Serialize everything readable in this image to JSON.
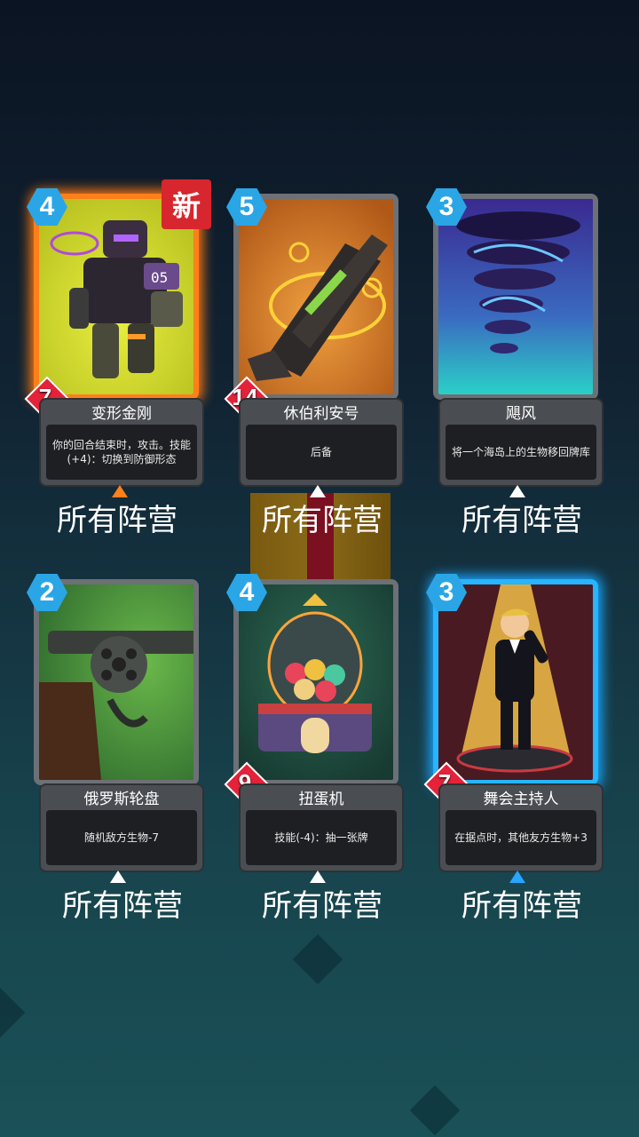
{
  "cards": [
    {
      "cost": "4",
      "attack": "7",
      "name": "变形金刚",
      "desc": "你的回合结束时，攻击。技能(+4)：切换到防御形态",
      "faction": "所有阵营",
      "badge": "新",
      "glow": "orange",
      "art": "transformer-robot-art"
    },
    {
      "cost": "5",
      "attack": "14",
      "name": "休伯利安号",
      "desc": "后备",
      "faction": "所有阵营",
      "glow": "none",
      "art": "spaceship-art"
    },
    {
      "cost": "3",
      "name": "飓风",
      "desc": "将一个海岛上的生物移回牌库",
      "faction": "所有阵营",
      "glow": "none",
      "art": "tornado-art"
    },
    {
      "cost": "2",
      "name": "俄罗斯轮盘",
      "desc": "随机敌方生物-7",
      "faction": "所有阵营",
      "glow": "none",
      "art": "revolver-art"
    },
    {
      "cost": "4",
      "attack": "9",
      "name": "扭蛋机",
      "desc": "技能(-4)：抽一张牌",
      "faction": "所有阵营",
      "glow": "none",
      "art": "gacha-machine-art"
    },
    {
      "cost": "3",
      "attack": "7",
      "name": "舞会主持人",
      "desc": "在据点时，其他友方生物+3",
      "faction": "所有阵营",
      "glow": "blue",
      "art": "host-art"
    }
  ],
  "colors": {
    "orange_glow": "#ff7f1a",
    "blue_glow": "#26b5ff",
    "cost": "#2aa6e6",
    "attack": "#e4223a",
    "new_badge": "#d8262e"
  }
}
